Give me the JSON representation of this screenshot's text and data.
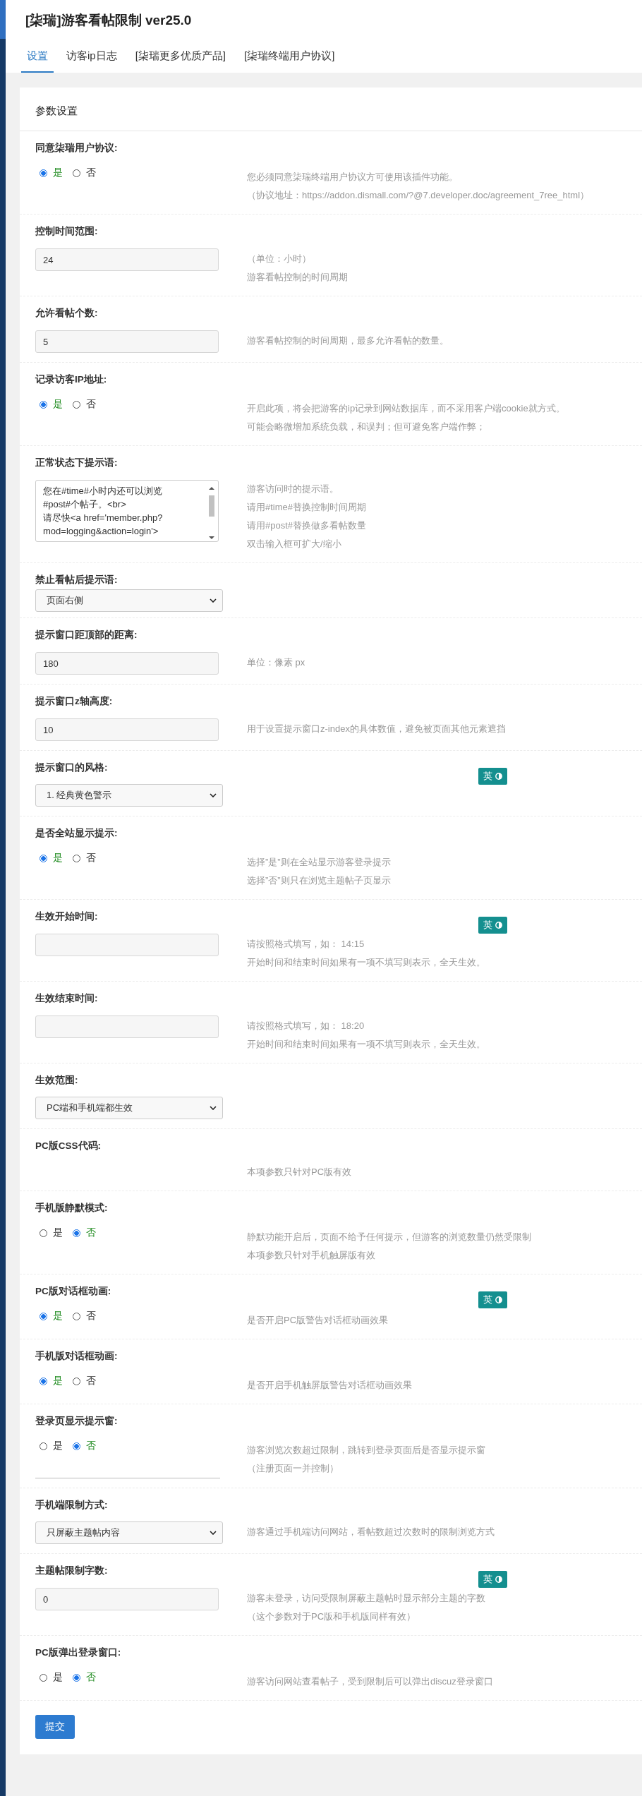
{
  "title": "[柒瑞]游客看帖限制 ver25.0",
  "tabs": [
    {
      "label": "设置",
      "selected": true
    },
    {
      "label": "访客ip日志",
      "selected": false
    },
    {
      "label": "[柒瑞更多优质产品]",
      "selected": false
    },
    {
      "label": "[柒瑞终端用户协议]",
      "selected": false
    }
  ],
  "panel": {
    "heading": "参数设置",
    "rows": [
      {
        "kind": "radio",
        "label": "同意柒瑞用户协议:",
        "options": [
          {
            "label": "是",
            "selected": true
          },
          {
            "label": "否",
            "selected": false
          }
        ],
        "help": [
          "您必须同意柒瑞终端用户协议方可使用该插件功能。",
          "（协议地址：https://addon.dismall.com/?@7.developer.doc/agreement_7ree_html）"
        ]
      },
      {
        "kind": "input",
        "label": "控制时间范围:",
        "value": "24",
        "help": [
          "（单位：小时）",
          "游客看帖控制的时间周期"
        ]
      },
      {
        "kind": "input",
        "label": "允许看帖个数:",
        "value": "5",
        "help": [
          "游客看帖控制的时间周期，最多允许看帖的数量。"
        ]
      },
      {
        "kind": "radio",
        "label": "记录访客IP地址:",
        "options": [
          {
            "label": "是",
            "selected": true
          },
          {
            "label": "否",
            "selected": false
          }
        ],
        "help": [
          "开启此项，将会把游客的ip记录到网站数据库，而不采用客户端cookie就方式。",
          "可能会略微增加系统负载，和误判；但可避免客户端作弊；"
        ]
      },
      {
        "kind": "textarea",
        "label": "正常状态下提示语:",
        "lines": [
          "您在#time#小时内还可以浏览",
          "#post#个帖子。<br>",
          "请尽快<a href='member.php?",
          "mod=logging&action=login'>"
        ],
        "help": [
          "游客访问时的提示语。",
          "请用#time#替换控制时间周期",
          "请用#post#替换做多看帖数量",
          "双击输入框可扩大/缩小"
        ]
      },
      {
        "kind": "compact_select",
        "label": "禁止看帖后提示语:",
        "value": "页面右侧",
        "help": []
      },
      {
        "kind": "input",
        "label": "提示窗口距顶部的距离:",
        "value": "180",
        "help": [
          "单位：像素 px"
        ]
      },
      {
        "kind": "input",
        "label": "提示窗口z轴高度:",
        "value": "10",
        "help": [
          "用于设置提示窗口z-index的具体数值，避免被页面其他元素遮挡"
        ]
      },
      {
        "kind": "select",
        "label": "提示窗口的风格:",
        "value": "1. 经典黄色警示",
        "help": [],
        "badge": "英"
      },
      {
        "kind": "radio",
        "label": "是否全站显示提示:",
        "options": [
          {
            "label": "是",
            "selected": true
          },
          {
            "label": "否",
            "selected": false
          }
        ],
        "help": [
          "选择”是”则在全站显示游客登录提示",
          "选择”否”则只在浏览主题帖子页显示"
        ]
      },
      {
        "kind": "input",
        "label": "生效开始时间:",
        "value": "",
        "help": [
          "请按照格式填写，如： 14:15",
          "开始时间和结束时间如果有一项不填写则表示，全天生效。"
        ],
        "badge": "英"
      },
      {
        "kind": "input",
        "label": "生效结束时间:",
        "value": "",
        "help": [
          "请按照格式填写，如： 18:20",
          "开始时间和结束时间如果有一项不填写则表示，全天生效。"
        ]
      },
      {
        "kind": "select",
        "label": "生效范围:",
        "value": "PC端和手机端都生效",
        "help": []
      },
      {
        "kind": "text",
        "label": "PC版CSS代码:",
        "help": [
          "本项参数只针对PC版有效"
        ]
      },
      {
        "kind": "radio",
        "label": "手机版静默模式:",
        "options": [
          {
            "label": "是",
            "selected": false
          },
          {
            "label": "否",
            "selected": true
          }
        ],
        "help": [
          "静默功能开启后，页面不给予任何提示，但游客的浏览数量仍然受限制",
          "本项参数只针对手机触屏版有效"
        ]
      },
      {
        "kind": "radio",
        "label": "PC版对话框动画:",
        "options": [
          {
            "label": "是",
            "selected": true
          },
          {
            "label": "否",
            "selected": false
          }
        ],
        "help": [
          "是否开启PC版警告对话框动画效果"
        ],
        "badge": "英"
      },
      {
        "kind": "radio",
        "label": "手机版对话框动画:",
        "options": [
          {
            "label": "是",
            "selected": true
          },
          {
            "label": "否",
            "selected": false
          }
        ],
        "help": [
          "是否开启手机触屏版警告对话框动画效果"
        ]
      },
      {
        "kind": "radio",
        "label": "登录页显示提示窗:",
        "options": [
          {
            "label": "是",
            "selected": false
          },
          {
            "label": "否",
            "selected": true
          }
        ],
        "help": [
          "游客浏览次数超过限制，跳转到登录页面后是否显示提示窗",
          "（注册页面一并控制）"
        ],
        "extra_line": true
      },
      {
        "kind": "select",
        "label": "手机端限制方式:",
        "value": "只屏蔽主题帖内容",
        "help": [
          "游客通过手机端访问网站，看帖数超过次数时的限制浏览方式"
        ]
      },
      {
        "kind": "input",
        "label": "主题帖限制字数:",
        "value": "0",
        "help": [
          "游客未登录，访问受限制屏蔽主题帖时显示部分主题的字数",
          "（这个参数对于PC版和手机版同样有效）"
        ],
        "badge": "英"
      },
      {
        "kind": "radio",
        "label": "PC版弹出登录窗口:",
        "options": [
          {
            "label": "是",
            "selected": false
          },
          {
            "label": "否",
            "selected": true
          }
        ],
        "help": [
          "游客访问网站查看帖子，受到限制后可以弹出discuz登录窗口"
        ]
      }
    ],
    "submit": "提交"
  }
}
